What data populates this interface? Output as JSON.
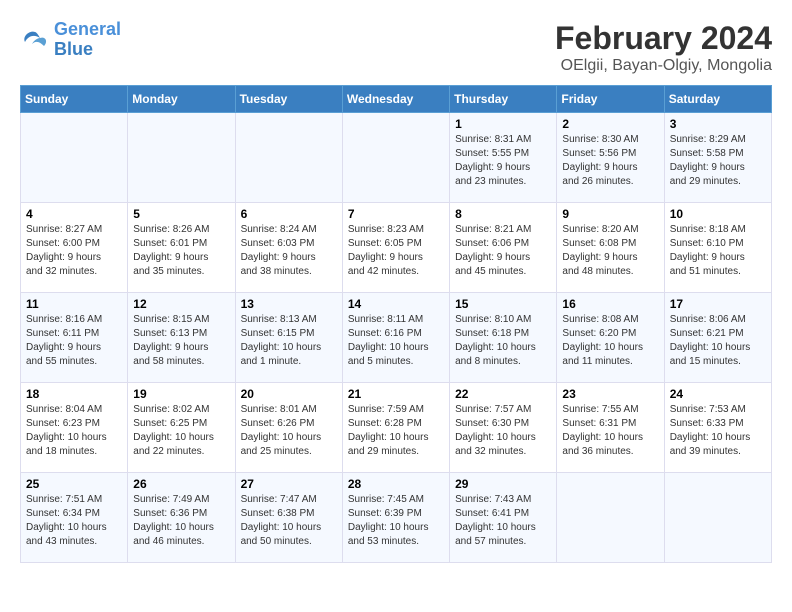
{
  "header": {
    "logo_line1": "General",
    "logo_line2": "Blue",
    "title": "February 2024",
    "subtitle": "OElgii, Bayan-Olgiy, Mongolia"
  },
  "weekdays": [
    "Sunday",
    "Monday",
    "Tuesday",
    "Wednesday",
    "Thursday",
    "Friday",
    "Saturday"
  ],
  "weeks": [
    [
      {
        "day": "",
        "info": ""
      },
      {
        "day": "",
        "info": ""
      },
      {
        "day": "",
        "info": ""
      },
      {
        "day": "",
        "info": ""
      },
      {
        "day": "1",
        "info": "Sunrise: 8:31 AM\nSunset: 5:55 PM\nDaylight: 9 hours\nand 23 minutes."
      },
      {
        "day": "2",
        "info": "Sunrise: 8:30 AM\nSunset: 5:56 PM\nDaylight: 9 hours\nand 26 minutes."
      },
      {
        "day": "3",
        "info": "Sunrise: 8:29 AM\nSunset: 5:58 PM\nDaylight: 9 hours\nand 29 minutes."
      }
    ],
    [
      {
        "day": "4",
        "info": "Sunrise: 8:27 AM\nSunset: 6:00 PM\nDaylight: 9 hours\nand 32 minutes."
      },
      {
        "day": "5",
        "info": "Sunrise: 8:26 AM\nSunset: 6:01 PM\nDaylight: 9 hours\nand 35 minutes."
      },
      {
        "day": "6",
        "info": "Sunrise: 8:24 AM\nSunset: 6:03 PM\nDaylight: 9 hours\nand 38 minutes."
      },
      {
        "day": "7",
        "info": "Sunrise: 8:23 AM\nSunset: 6:05 PM\nDaylight: 9 hours\nand 42 minutes."
      },
      {
        "day": "8",
        "info": "Sunrise: 8:21 AM\nSunset: 6:06 PM\nDaylight: 9 hours\nand 45 minutes."
      },
      {
        "day": "9",
        "info": "Sunrise: 8:20 AM\nSunset: 6:08 PM\nDaylight: 9 hours\nand 48 minutes."
      },
      {
        "day": "10",
        "info": "Sunrise: 8:18 AM\nSunset: 6:10 PM\nDaylight: 9 hours\nand 51 minutes."
      }
    ],
    [
      {
        "day": "11",
        "info": "Sunrise: 8:16 AM\nSunset: 6:11 PM\nDaylight: 9 hours\nand 55 minutes."
      },
      {
        "day": "12",
        "info": "Sunrise: 8:15 AM\nSunset: 6:13 PM\nDaylight: 9 hours\nand 58 minutes."
      },
      {
        "day": "13",
        "info": "Sunrise: 8:13 AM\nSunset: 6:15 PM\nDaylight: 10 hours\nand 1 minute."
      },
      {
        "day": "14",
        "info": "Sunrise: 8:11 AM\nSunset: 6:16 PM\nDaylight: 10 hours\nand 5 minutes."
      },
      {
        "day": "15",
        "info": "Sunrise: 8:10 AM\nSunset: 6:18 PM\nDaylight: 10 hours\nand 8 minutes."
      },
      {
        "day": "16",
        "info": "Sunrise: 8:08 AM\nSunset: 6:20 PM\nDaylight: 10 hours\nand 11 minutes."
      },
      {
        "day": "17",
        "info": "Sunrise: 8:06 AM\nSunset: 6:21 PM\nDaylight: 10 hours\nand 15 minutes."
      }
    ],
    [
      {
        "day": "18",
        "info": "Sunrise: 8:04 AM\nSunset: 6:23 PM\nDaylight: 10 hours\nand 18 minutes."
      },
      {
        "day": "19",
        "info": "Sunrise: 8:02 AM\nSunset: 6:25 PM\nDaylight: 10 hours\nand 22 minutes."
      },
      {
        "day": "20",
        "info": "Sunrise: 8:01 AM\nSunset: 6:26 PM\nDaylight: 10 hours\nand 25 minutes."
      },
      {
        "day": "21",
        "info": "Sunrise: 7:59 AM\nSunset: 6:28 PM\nDaylight: 10 hours\nand 29 minutes."
      },
      {
        "day": "22",
        "info": "Sunrise: 7:57 AM\nSunset: 6:30 PM\nDaylight: 10 hours\nand 32 minutes."
      },
      {
        "day": "23",
        "info": "Sunrise: 7:55 AM\nSunset: 6:31 PM\nDaylight: 10 hours\nand 36 minutes."
      },
      {
        "day": "24",
        "info": "Sunrise: 7:53 AM\nSunset: 6:33 PM\nDaylight: 10 hours\nand 39 minutes."
      }
    ],
    [
      {
        "day": "25",
        "info": "Sunrise: 7:51 AM\nSunset: 6:34 PM\nDaylight: 10 hours\nand 43 minutes."
      },
      {
        "day": "26",
        "info": "Sunrise: 7:49 AM\nSunset: 6:36 PM\nDaylight: 10 hours\nand 46 minutes."
      },
      {
        "day": "27",
        "info": "Sunrise: 7:47 AM\nSunset: 6:38 PM\nDaylight: 10 hours\nand 50 minutes."
      },
      {
        "day": "28",
        "info": "Sunrise: 7:45 AM\nSunset: 6:39 PM\nDaylight: 10 hours\nand 53 minutes."
      },
      {
        "day": "29",
        "info": "Sunrise: 7:43 AM\nSunset: 6:41 PM\nDaylight: 10 hours\nand 57 minutes."
      },
      {
        "day": "",
        "info": ""
      },
      {
        "day": "",
        "info": ""
      }
    ]
  ]
}
